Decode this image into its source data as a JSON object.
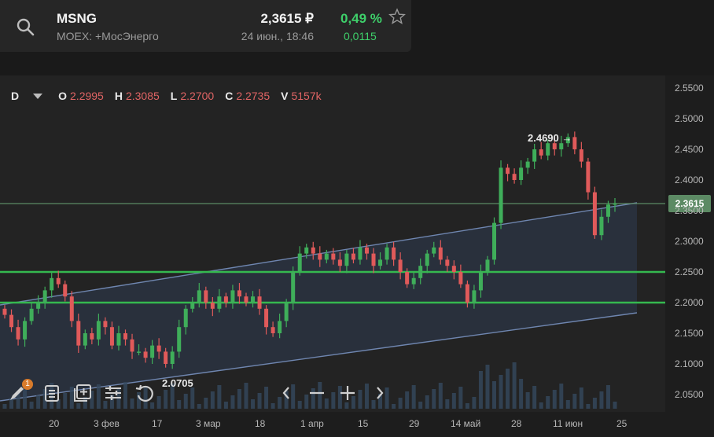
{
  "header": {
    "symbol": "MSNG",
    "exchange": "MOEX: +МосЭнерго",
    "price": "2,3615 ₽",
    "time": "24 июн., 18:46",
    "change_pct": "0,49 %",
    "change_abs": "0,0115",
    "icons": [
      "search-icon",
      "star-icon"
    ]
  },
  "legend": {
    "period": "D",
    "o_label": "O",
    "o_value": "2.2995",
    "h_label": "H",
    "h_value": "2.3085",
    "l_label": "L",
    "l_value": "2.2700",
    "c_label": "C",
    "c_value": "2.2735",
    "v_label": "V",
    "v_value": "5157k"
  },
  "annotations": {
    "high": "2.4690 →",
    "low": "2.0705",
    "last_price": "2.3615",
    "draw_badge": "1"
  },
  "colors": {
    "up": "#3fae5a",
    "down": "#e05a5a",
    "level_line": "#35b84f",
    "channel": "#6f86b0"
  },
  "toolbar_icons": [
    "pencil-icon",
    "list-icon",
    "add-indicator-icon",
    "settings-sliders-icon",
    "reset-icon",
    "scroll-left-icon",
    "zoom-out-icon",
    "zoom-in-icon",
    "scroll-right-icon"
  ],
  "chart_data": {
    "type": "candlestick",
    "y_ticks": [
      "2.5500",
      "2.5000",
      "2.4500",
      "2.4000",
      "2.3500",
      "2.3000",
      "2.2500",
      "2.2000",
      "2.1500",
      "2.1000",
      "2.0500"
    ],
    "x_ticks": [
      "20",
      "3 фев",
      "17",
      "3 мар",
      "18",
      "1 апр",
      "15",
      "29",
      "14 май",
      "28",
      "11 июн",
      "25"
    ],
    "ylim": [
      2.03,
      2.555
    ],
    "horizontal_levels": [
      2.25,
      2.2
    ],
    "last_price": 2.3615,
    "high": 2.469,
    "low": 2.0705,
    "closes": [
      2.18,
      2.16,
      2.14,
      2.17,
      2.19,
      2.2,
      2.22,
      2.24,
      2.23,
      2.21,
      2.17,
      2.13,
      2.15,
      2.14,
      2.17,
      2.16,
      2.13,
      2.15,
      2.14,
      2.12,
      2.12,
      2.11,
      2.13,
      2.12,
      2.1,
      2.12,
      2.16,
      2.19,
      2.2,
      2.22,
      2.2,
      2.19,
      2.21,
      2.2,
      2.22,
      2.21,
      2.2,
      2.21,
      2.19,
      2.16,
      2.15,
      2.17,
      2.2,
      2.25,
      2.28,
      2.29,
      2.28,
      2.27,
      2.28,
      2.27,
      2.26,
      2.28,
      2.27,
      2.29,
      2.28,
      2.26,
      2.27,
      2.29,
      2.27,
      2.25,
      2.23,
      2.24,
      2.26,
      2.28,
      2.29,
      2.27,
      2.26,
      2.25,
      2.23,
      2.2,
      2.22,
      2.25,
      2.27,
      2.33,
      2.42,
      2.41,
      2.4,
      2.42,
      2.43,
      2.45,
      2.44,
      2.46,
      2.45,
      2.46,
      2.47,
      2.45,
      2.43,
      2.38,
      2.31,
      2.34,
      2.36,
      2.3615
    ]
  }
}
